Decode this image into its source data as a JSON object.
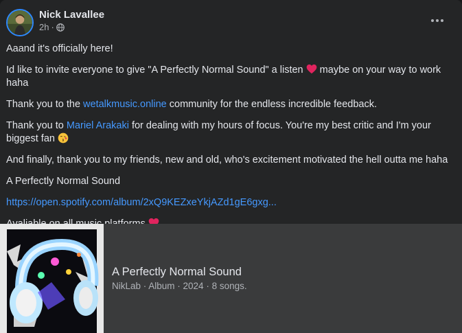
{
  "post": {
    "author": "Nick Lavallee",
    "time": "2h",
    "separator": "·",
    "audience_icon": "globe-icon",
    "more_icon": "more-options-icon"
  },
  "body": {
    "line1": "Aaand it's officially here!",
    "line2_text": "Id like to invite everyone to give \"A Perfectly Normal Sound\" a listen",
    "line2_after": " maybe on your way to work haha",
    "line3_before": "Thank you to the ",
    "line3_link": "wetalkmusic.online",
    "line3_after": " community for the endless incredible feedback.",
    "line4_before": "Thank you to ",
    "line4_link": "Mariel Arakaki",
    "line4_after": " for dealing with my hours of focus.  You're my best critic and I'm your biggest fan",
    "line5": "And finally, thank you to my friends,  new and old,  who's excitement motivated the hell outta me haha",
    "line6": "A Perfectly Normal Sound",
    "line7_link": "https://open.spotify.com/album/2xQ9KEZxeYkjAZd1gE6gxg...",
    "line8": "Avaliable on all music platforms"
  },
  "card": {
    "title": "A Perfectly Normal Sound",
    "subtitle": "NikLab · Album · 2024 · 8 songs."
  },
  "colors": {
    "background": "#242526",
    "text": "#e4e6eb",
    "secondary": "#b0b3b8",
    "link": "#4599ff",
    "card": "#3a3b3c",
    "heart": "#e0245e"
  }
}
